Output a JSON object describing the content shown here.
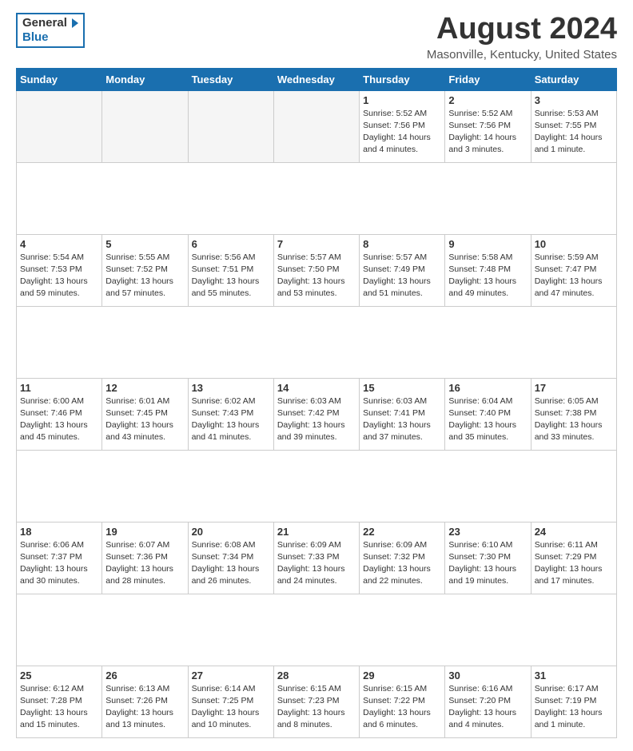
{
  "header": {
    "logo_general": "General",
    "logo_blue": "Blue",
    "month_year": "August 2024",
    "location": "Masonville, Kentucky, United States"
  },
  "days_of_week": [
    "Sunday",
    "Monday",
    "Tuesday",
    "Wednesday",
    "Thursday",
    "Friday",
    "Saturday"
  ],
  "weeks": [
    [
      {
        "day": "",
        "info": ""
      },
      {
        "day": "",
        "info": ""
      },
      {
        "day": "",
        "info": ""
      },
      {
        "day": "",
        "info": ""
      },
      {
        "day": "1",
        "info": "Sunrise: 5:52 AM\nSunset: 7:56 PM\nDaylight: 14 hours\nand 4 minutes."
      },
      {
        "day": "2",
        "info": "Sunrise: 5:52 AM\nSunset: 7:56 PM\nDaylight: 14 hours\nand 3 minutes."
      },
      {
        "day": "3",
        "info": "Sunrise: 5:53 AM\nSunset: 7:55 PM\nDaylight: 14 hours\nand 1 minute."
      }
    ],
    [
      {
        "day": "4",
        "info": "Sunrise: 5:54 AM\nSunset: 7:53 PM\nDaylight: 13 hours\nand 59 minutes."
      },
      {
        "day": "5",
        "info": "Sunrise: 5:55 AM\nSunset: 7:52 PM\nDaylight: 13 hours\nand 57 minutes."
      },
      {
        "day": "6",
        "info": "Sunrise: 5:56 AM\nSunset: 7:51 PM\nDaylight: 13 hours\nand 55 minutes."
      },
      {
        "day": "7",
        "info": "Sunrise: 5:57 AM\nSunset: 7:50 PM\nDaylight: 13 hours\nand 53 minutes."
      },
      {
        "day": "8",
        "info": "Sunrise: 5:57 AM\nSunset: 7:49 PM\nDaylight: 13 hours\nand 51 minutes."
      },
      {
        "day": "9",
        "info": "Sunrise: 5:58 AM\nSunset: 7:48 PM\nDaylight: 13 hours\nand 49 minutes."
      },
      {
        "day": "10",
        "info": "Sunrise: 5:59 AM\nSunset: 7:47 PM\nDaylight: 13 hours\nand 47 minutes."
      }
    ],
    [
      {
        "day": "11",
        "info": "Sunrise: 6:00 AM\nSunset: 7:46 PM\nDaylight: 13 hours\nand 45 minutes."
      },
      {
        "day": "12",
        "info": "Sunrise: 6:01 AM\nSunset: 7:45 PM\nDaylight: 13 hours\nand 43 minutes."
      },
      {
        "day": "13",
        "info": "Sunrise: 6:02 AM\nSunset: 7:43 PM\nDaylight: 13 hours\nand 41 minutes."
      },
      {
        "day": "14",
        "info": "Sunrise: 6:03 AM\nSunset: 7:42 PM\nDaylight: 13 hours\nand 39 minutes."
      },
      {
        "day": "15",
        "info": "Sunrise: 6:03 AM\nSunset: 7:41 PM\nDaylight: 13 hours\nand 37 minutes."
      },
      {
        "day": "16",
        "info": "Sunrise: 6:04 AM\nSunset: 7:40 PM\nDaylight: 13 hours\nand 35 minutes."
      },
      {
        "day": "17",
        "info": "Sunrise: 6:05 AM\nSunset: 7:38 PM\nDaylight: 13 hours\nand 33 minutes."
      }
    ],
    [
      {
        "day": "18",
        "info": "Sunrise: 6:06 AM\nSunset: 7:37 PM\nDaylight: 13 hours\nand 30 minutes."
      },
      {
        "day": "19",
        "info": "Sunrise: 6:07 AM\nSunset: 7:36 PM\nDaylight: 13 hours\nand 28 minutes."
      },
      {
        "day": "20",
        "info": "Sunrise: 6:08 AM\nSunset: 7:34 PM\nDaylight: 13 hours\nand 26 minutes."
      },
      {
        "day": "21",
        "info": "Sunrise: 6:09 AM\nSunset: 7:33 PM\nDaylight: 13 hours\nand 24 minutes."
      },
      {
        "day": "22",
        "info": "Sunrise: 6:09 AM\nSunset: 7:32 PM\nDaylight: 13 hours\nand 22 minutes."
      },
      {
        "day": "23",
        "info": "Sunrise: 6:10 AM\nSunset: 7:30 PM\nDaylight: 13 hours\nand 19 minutes."
      },
      {
        "day": "24",
        "info": "Sunrise: 6:11 AM\nSunset: 7:29 PM\nDaylight: 13 hours\nand 17 minutes."
      }
    ],
    [
      {
        "day": "25",
        "info": "Sunrise: 6:12 AM\nSunset: 7:28 PM\nDaylight: 13 hours\nand 15 minutes."
      },
      {
        "day": "26",
        "info": "Sunrise: 6:13 AM\nSunset: 7:26 PM\nDaylight: 13 hours\nand 13 minutes."
      },
      {
        "day": "27",
        "info": "Sunrise: 6:14 AM\nSunset: 7:25 PM\nDaylight: 13 hours\nand 10 minutes."
      },
      {
        "day": "28",
        "info": "Sunrise: 6:15 AM\nSunset: 7:23 PM\nDaylight: 13 hours\nand 8 minutes."
      },
      {
        "day": "29",
        "info": "Sunrise: 6:15 AM\nSunset: 7:22 PM\nDaylight: 13 hours\nand 6 minutes."
      },
      {
        "day": "30",
        "info": "Sunrise: 6:16 AM\nSunset: 7:20 PM\nDaylight: 13 hours\nand 4 minutes."
      },
      {
        "day": "31",
        "info": "Sunrise: 6:17 AM\nSunset: 7:19 PM\nDaylight: 13 hours\nand 1 minute."
      }
    ]
  ]
}
